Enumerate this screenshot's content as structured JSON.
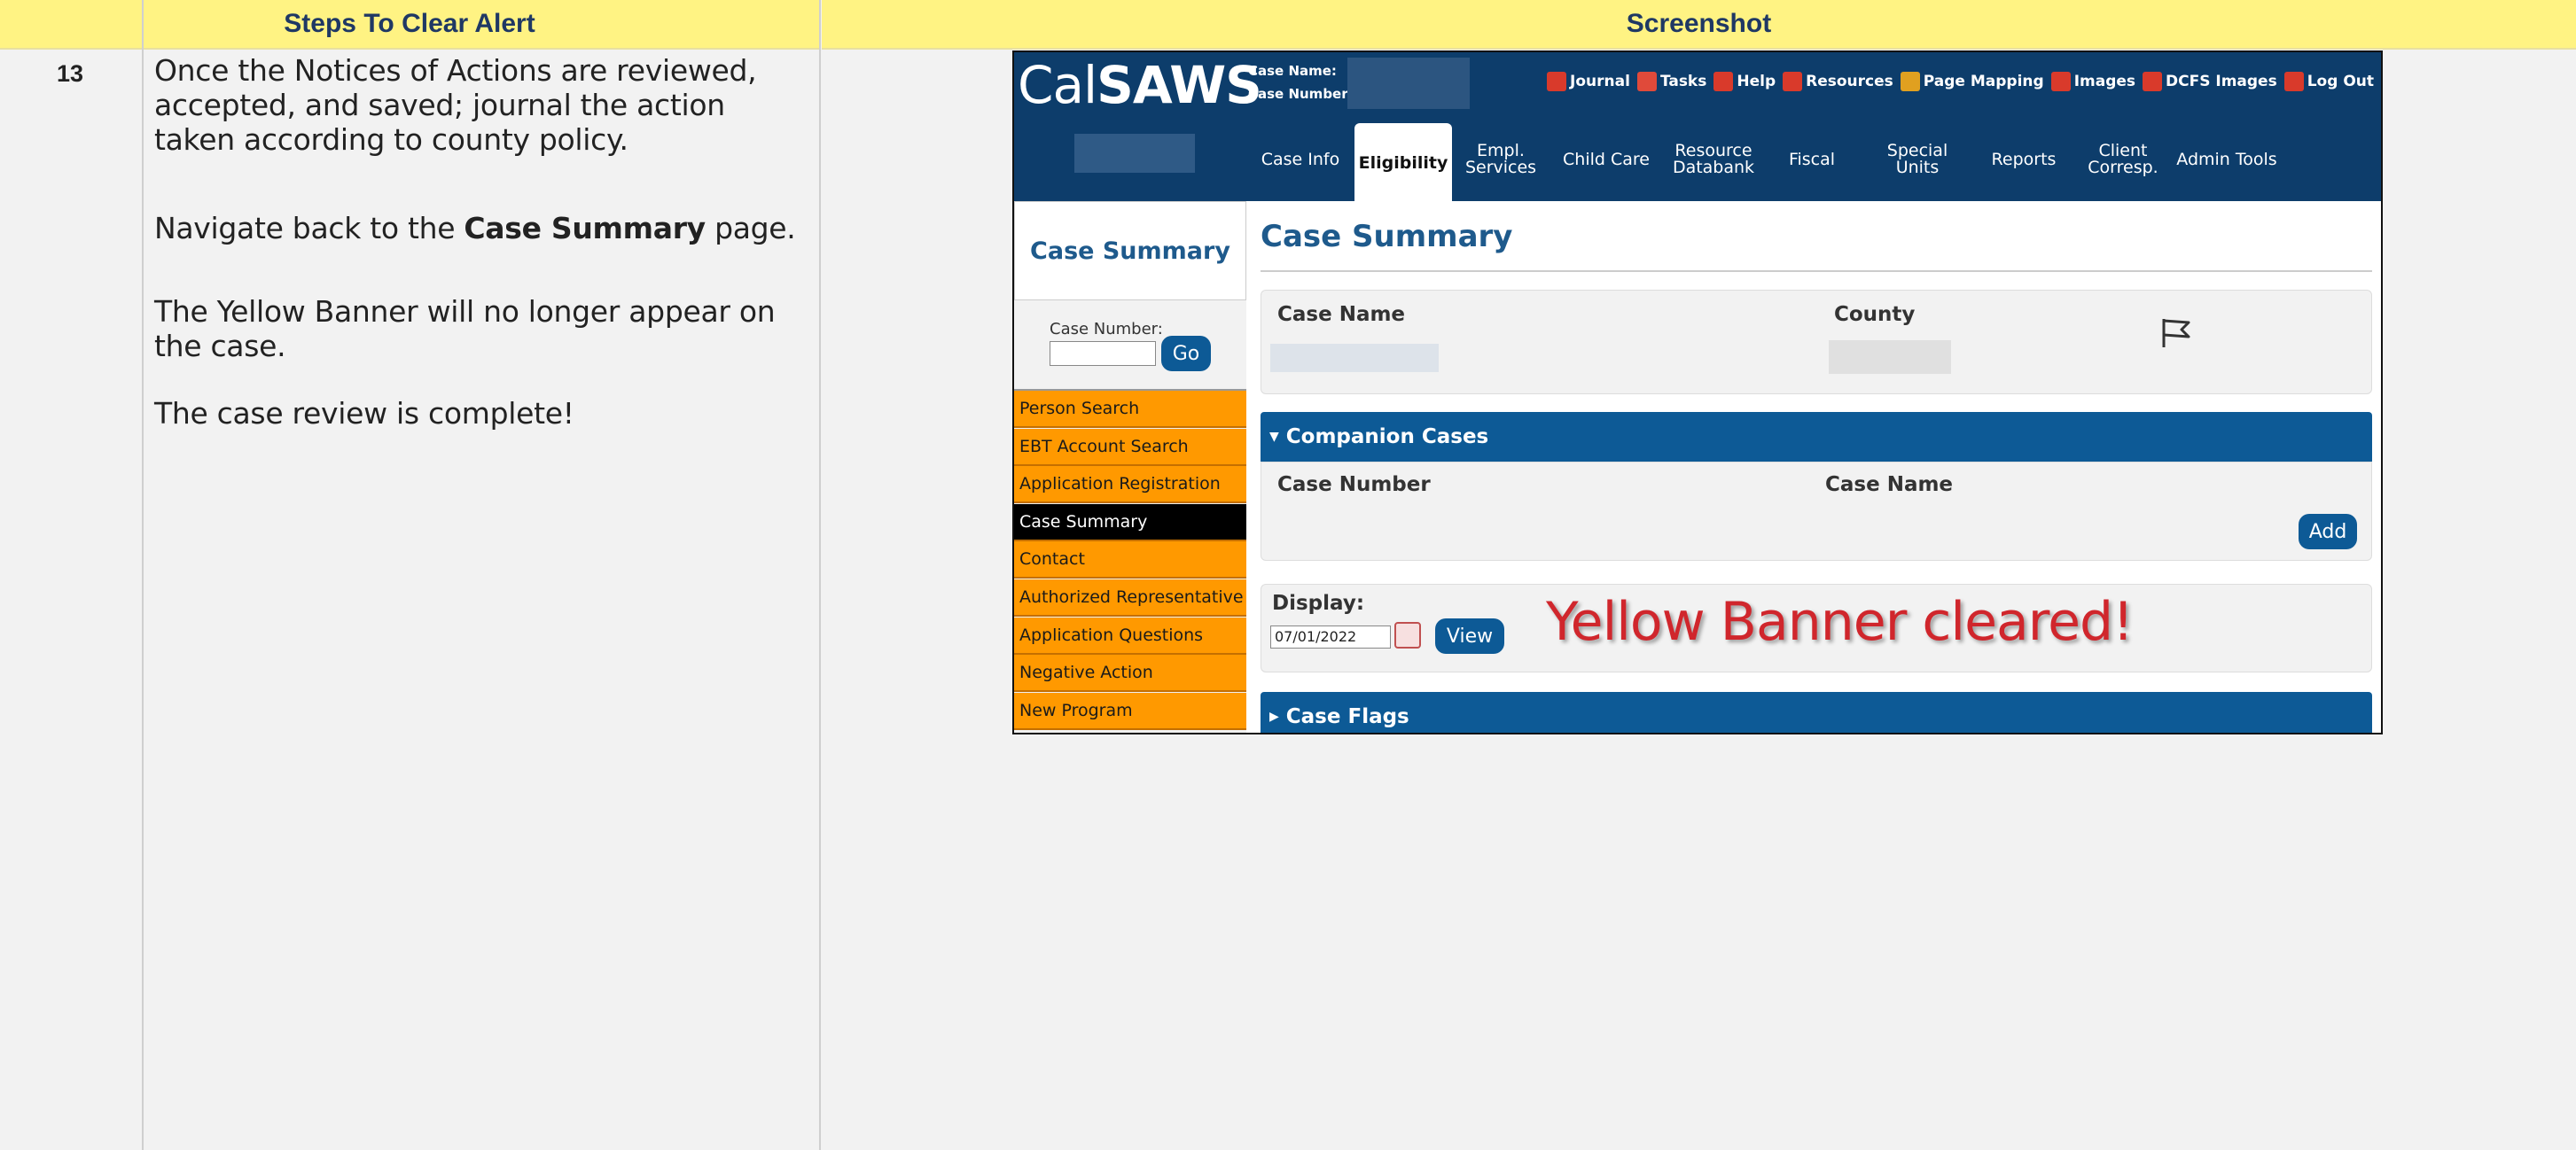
{
  "headers": {
    "steps": "Steps To Clear Alert",
    "screenshot": "Screenshot"
  },
  "step": {
    "number": "13",
    "p1": "Once the Notices of Actions are reviewed, accepted, and saved; journal the action taken according to county policy.",
    "p2_before": "Navigate back to the ",
    "p2_bold": "Case Summary",
    "p2_after": " page.",
    "p3": "The Yellow Banner will no longer appear on the case.",
    "p4": "The case review is complete!"
  },
  "app": {
    "logo_light": "Cal",
    "logo_bold": "SAWS",
    "case_name_label": "Case Name:",
    "case_number_label": "Case Number:",
    "top_links": [
      {
        "label": "Journal",
        "icon": "journal-icon",
        "color": "#d93a2b"
      },
      {
        "label": "Tasks",
        "icon": "tasks-icon",
        "color": "#e04a3a"
      },
      {
        "label": "Help",
        "icon": "help-icon",
        "color": "#d93a2b"
      },
      {
        "label": "Resources",
        "icon": "resources-icon",
        "color": "#d93a2b"
      },
      {
        "label": "Page Mapping",
        "icon": "page-mapping-icon",
        "color": "#e0a020"
      },
      {
        "label": "Images",
        "icon": "images-icon",
        "color": "#d93a2b"
      },
      {
        "label": "DCFS Images",
        "icon": "dcfs-images-icon",
        "color": "#d93a2b"
      },
      {
        "label": "Log Out",
        "icon": "logout-icon",
        "color": "#d93a2b"
      }
    ],
    "tabs": [
      {
        "l1": "Case Info",
        "l2": ""
      },
      {
        "l1": "Eligibility",
        "l2": ""
      },
      {
        "l1": "Empl.",
        "l2": "Services"
      },
      {
        "l1": "Child Care",
        "l2": ""
      },
      {
        "l1": "Resource",
        "l2": "Databank"
      },
      {
        "l1": "Fiscal",
        "l2": ""
      },
      {
        "l1": "Special",
        "l2": "Units"
      },
      {
        "l1": "Reports",
        "l2": ""
      },
      {
        "l1": "Client",
        "l2": "Corresp."
      },
      {
        "l1": "Admin Tools",
        "l2": ""
      }
    ],
    "leftnav": {
      "title": "Case Summary",
      "case_number_label": "Case Number:",
      "go": "Go",
      "links": [
        "Person Search",
        "EBT Account Search",
        "Application Registration",
        "Case Summary",
        "Contact",
        "Authorized Representative",
        "Application Questions",
        "Negative Action",
        "New Program"
      ]
    },
    "main": {
      "title": "Case Summary",
      "case_name_label": "Case Name",
      "county_label": "County",
      "companion_cases": "Companion Cases",
      "case_number_col": "Case Number",
      "case_name_col": "Case Name",
      "add": "Add",
      "display_label": "Display:",
      "display_date": "07/01/2022",
      "view": "View",
      "case_flags": "Case Flags"
    },
    "annotation": "Yellow Banner cleared!"
  }
}
